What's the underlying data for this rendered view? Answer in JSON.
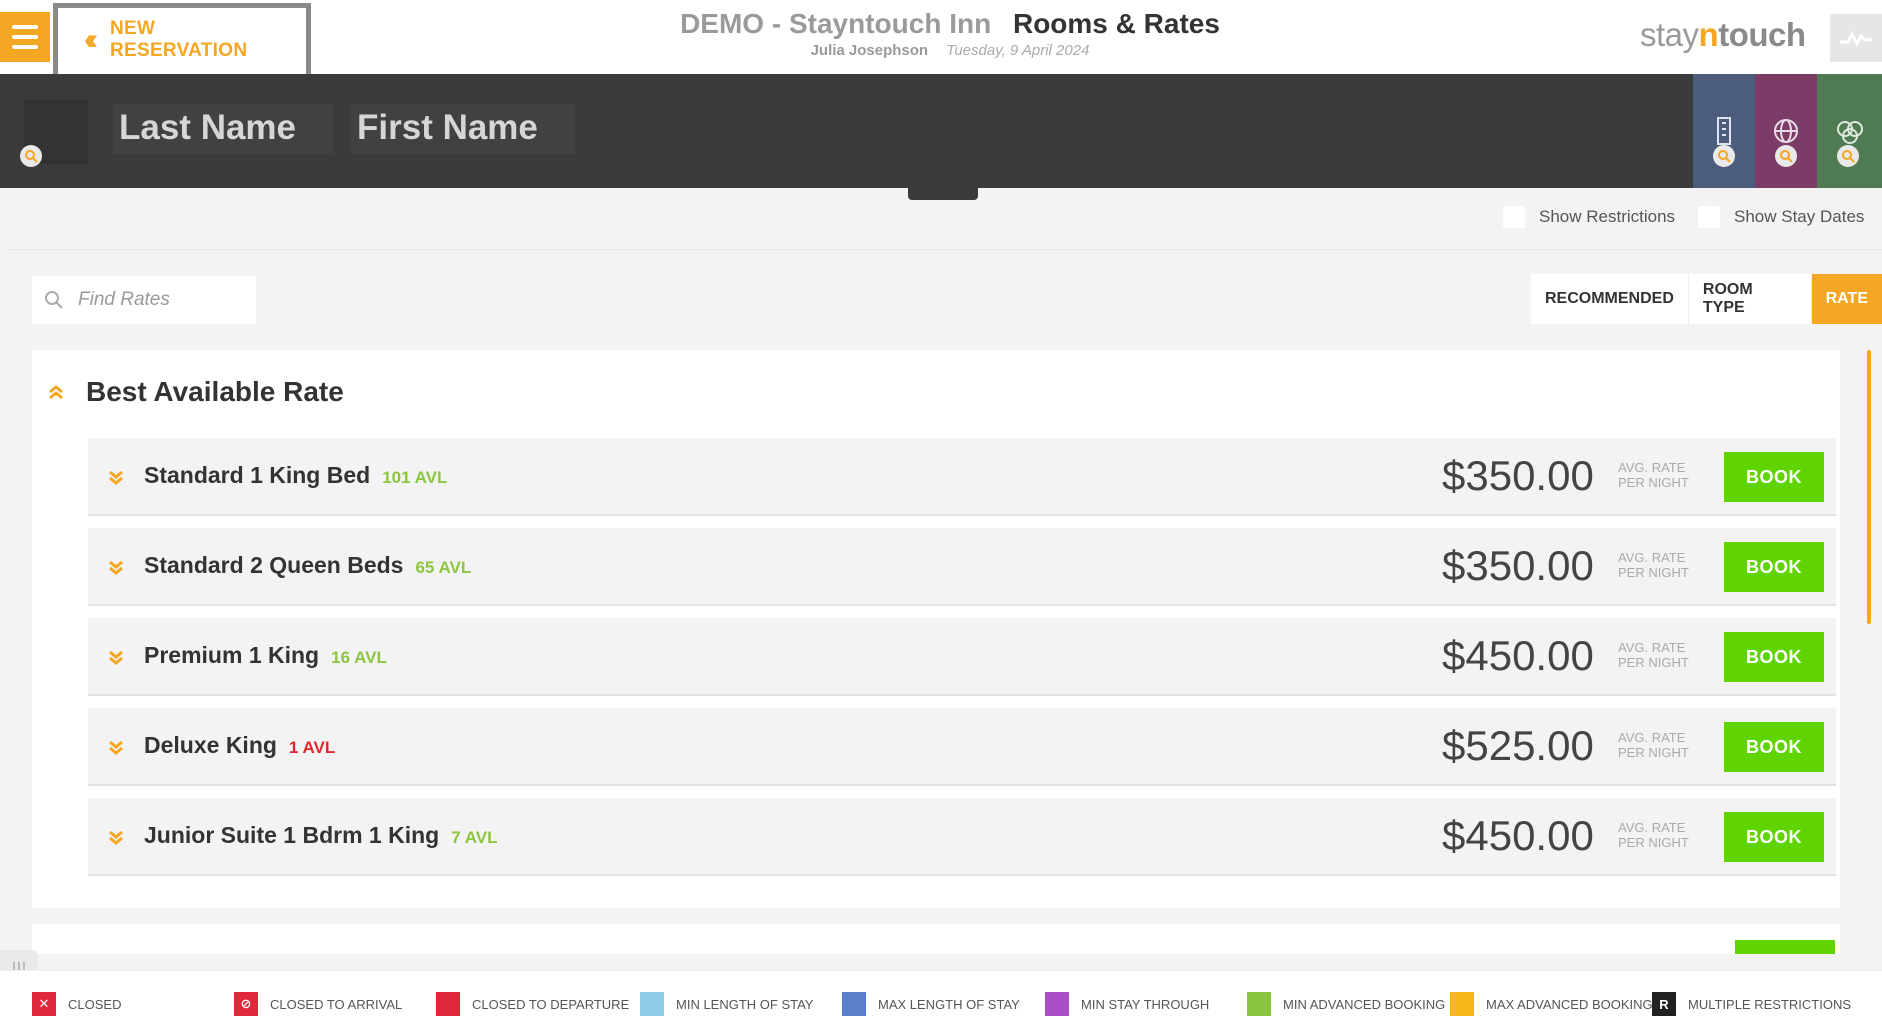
{
  "header": {
    "back_label": "NEW RESERVATION",
    "hotel_name": "DEMO - Stayntouch Inn",
    "page_title": "Rooms & Rates",
    "user_name": "Julia Josephson",
    "date": "Tuesday, 9 April 2024",
    "brand": {
      "part1": "stay",
      "part2": "n",
      "part3": "touch"
    }
  },
  "guest": {
    "last_name_placeholder": "Last Name",
    "first_name_placeholder": "First Name"
  },
  "options": {
    "show_restrictions": "Show Restrictions",
    "show_stay_dates": "Show Stay Dates"
  },
  "search": {
    "placeholder": "Find Rates"
  },
  "filters": [
    {
      "label": "RECOMMENDED",
      "active": false
    },
    {
      "label": "ROOM TYPE",
      "active": false
    },
    {
      "label": "RATE",
      "active": true
    }
  ],
  "rate_group": {
    "title": "Best Available Rate",
    "rooms": [
      {
        "name": "Standard 1 King Bed",
        "avl": "101 AVL",
        "price": "$350.00",
        "avg_label": "AVG. RATE PER NIGHT",
        "book": "BOOK"
      },
      {
        "name": "Standard 2 Queen Beds",
        "avl": "65 AVL",
        "price": "$350.00",
        "avg_label": "AVG. RATE PER NIGHT",
        "book": "BOOK"
      },
      {
        "name": "Premium 1 King",
        "avl": "16 AVL",
        "price": "$450.00",
        "avg_label": "AVG. RATE PER NIGHT",
        "book": "BOOK"
      },
      {
        "name": "Deluxe King",
        "avl": "1 AVL",
        "price": "$525.00",
        "avg_label": "AVG. RATE PER NIGHT",
        "book": "BOOK"
      },
      {
        "name": "Junior Suite 1 Bdrm 1 King",
        "avl": "7 AVL",
        "price": "$450.00",
        "avg_label": "AVG. RATE PER NIGHT",
        "book": "BOOK"
      }
    ]
  },
  "legend": [
    {
      "label": "CLOSED",
      "color": "#e0283a"
    },
    {
      "label": "CLOSED TO ARRIVAL",
      "color": "#e0283a"
    },
    {
      "label": "CLOSED TO DEPARTURE",
      "color": "#e0283a"
    },
    {
      "label": "MIN LENGTH OF STAY",
      "color": "#8ecde6"
    },
    {
      "label": "MAX LENGTH OF STAY",
      "color": "#5b7fc8"
    },
    {
      "label": "MIN STAY THROUGH",
      "color": "#a94fc6"
    },
    {
      "label": "MIN ADVANCED BOOKING",
      "color": "#8cc63f"
    },
    {
      "label": "MAX ADVANCED BOOKING",
      "color": "#f5b818"
    },
    {
      "label": "MULTIPLE RESTRICTIONS",
      "color": "#222222",
      "symbol": "R"
    }
  ],
  "colors": {
    "accent": "#f5a623",
    "book_green": "#5fd400",
    "avl_green": "#8cc63f",
    "avl_low": "#e0282e",
    "guest_bar": "#3a3b3d"
  }
}
